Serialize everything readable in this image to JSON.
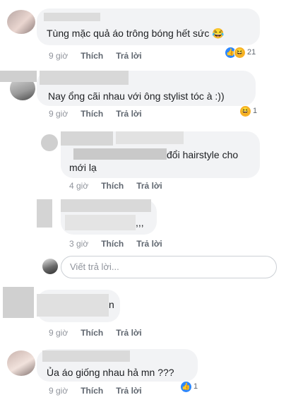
{
  "actions": {
    "like": "Thích",
    "reply": "Trả lời"
  },
  "comments": [
    {
      "text": "Tùng mặc quả áo trông bóng hết sức",
      "emoji": "😂",
      "time": "9 giờ",
      "reaction_count": "21"
    },
    {
      "text": "Nay ổng cãi nhau với ông stylist tóc à :))",
      "time": "9 giờ",
      "reaction_count": "1"
    },
    {
      "text_line1": "đổi hairstyle cho",
      "text_line2": "mới lạ",
      "time": "4 giờ"
    },
    {
      "text": ",,,",
      "time": "3 giờ"
    },
    {
      "text": "n",
      "time": "9 giờ"
    },
    {
      "text": "Ủa áo giống nhau hả mn ???",
      "time": "9 giờ",
      "reaction_count": "1"
    }
  ],
  "reply_input": {
    "placeholder": "Viết trả lời..."
  },
  "icons": {
    "like": "like-icon",
    "haha": "haha-icon"
  },
  "colors": {
    "like": "#2d88ff",
    "haha": "#f7b125",
    "bubble": "#f2f3f5",
    "meta": "#606770"
  }
}
